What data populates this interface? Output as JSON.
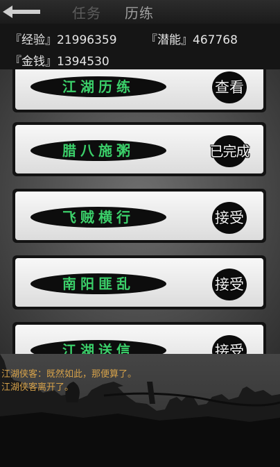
{
  "header": {
    "tab_task": "任务",
    "tab_training": "历练"
  },
  "stats": {
    "experience": "『经验』21996359",
    "potential": "『潜能』467768",
    "gold": "『金钱』1394530"
  },
  "quests": [
    {
      "title": "江湖历练",
      "action": "查看"
    },
    {
      "title": "腊八施粥",
      "action": "已完成"
    },
    {
      "title": "飞贼横行",
      "action": "接受"
    },
    {
      "title": "南阳匪乱",
      "action": "接受"
    },
    {
      "title": "江湖送信",
      "action": "接受"
    }
  ],
  "log": {
    "line1": "江湖侠客：既然如此，那便算了。",
    "line2": "江湖侠客离开了。"
  },
  "colors": {
    "quest_title": "#3bd06a",
    "log_text": "#d6a24a"
  }
}
